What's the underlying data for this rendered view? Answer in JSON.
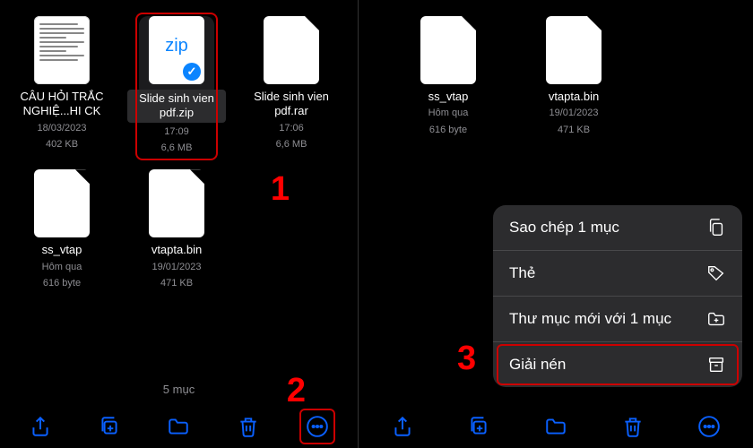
{
  "left_screen": {
    "files": [
      {
        "name": "CÂU HỎI TRẮC NGHIỆ...HI CK",
        "date": "18/03/2023",
        "size": "402 KB",
        "type": "doc"
      },
      {
        "name": "Slide sinh vien pdf.zip",
        "date": "17:09",
        "size": "6,6 MB",
        "type": "zip",
        "selected": true
      },
      {
        "name": "Slide sinh vien pdf.rar",
        "date": "17:06",
        "size": "6,6 MB",
        "type": "file"
      },
      {
        "name": "ss_vtap",
        "date": "Hôm qua",
        "size": "616 byte",
        "type": "file"
      },
      {
        "name": "vtapta.bin",
        "date": "19/01/2023",
        "size": "471 KB",
        "type": "file"
      }
    ],
    "count_label": "5 mục"
  },
  "right_screen": {
    "files": [
      {
        "name": "ss_vtap",
        "date": "Hôm qua",
        "size": "616 byte",
        "type": "file"
      },
      {
        "name": "vtapta.bin",
        "date": "19/01/2023",
        "size": "471 KB",
        "type": "file"
      }
    ],
    "context_menu": [
      {
        "label": "Sao chép 1 mục",
        "icon": "copy"
      },
      {
        "label": "Thẻ",
        "icon": "tag"
      },
      {
        "label": "Thư mục mới với 1 mục",
        "icon": "folder-plus"
      },
      {
        "label": "Giải nén",
        "icon": "archive"
      }
    ]
  },
  "steps": {
    "1": "1",
    "2": "2",
    "3": "3"
  },
  "icons": {
    "zip_text": "zip"
  }
}
